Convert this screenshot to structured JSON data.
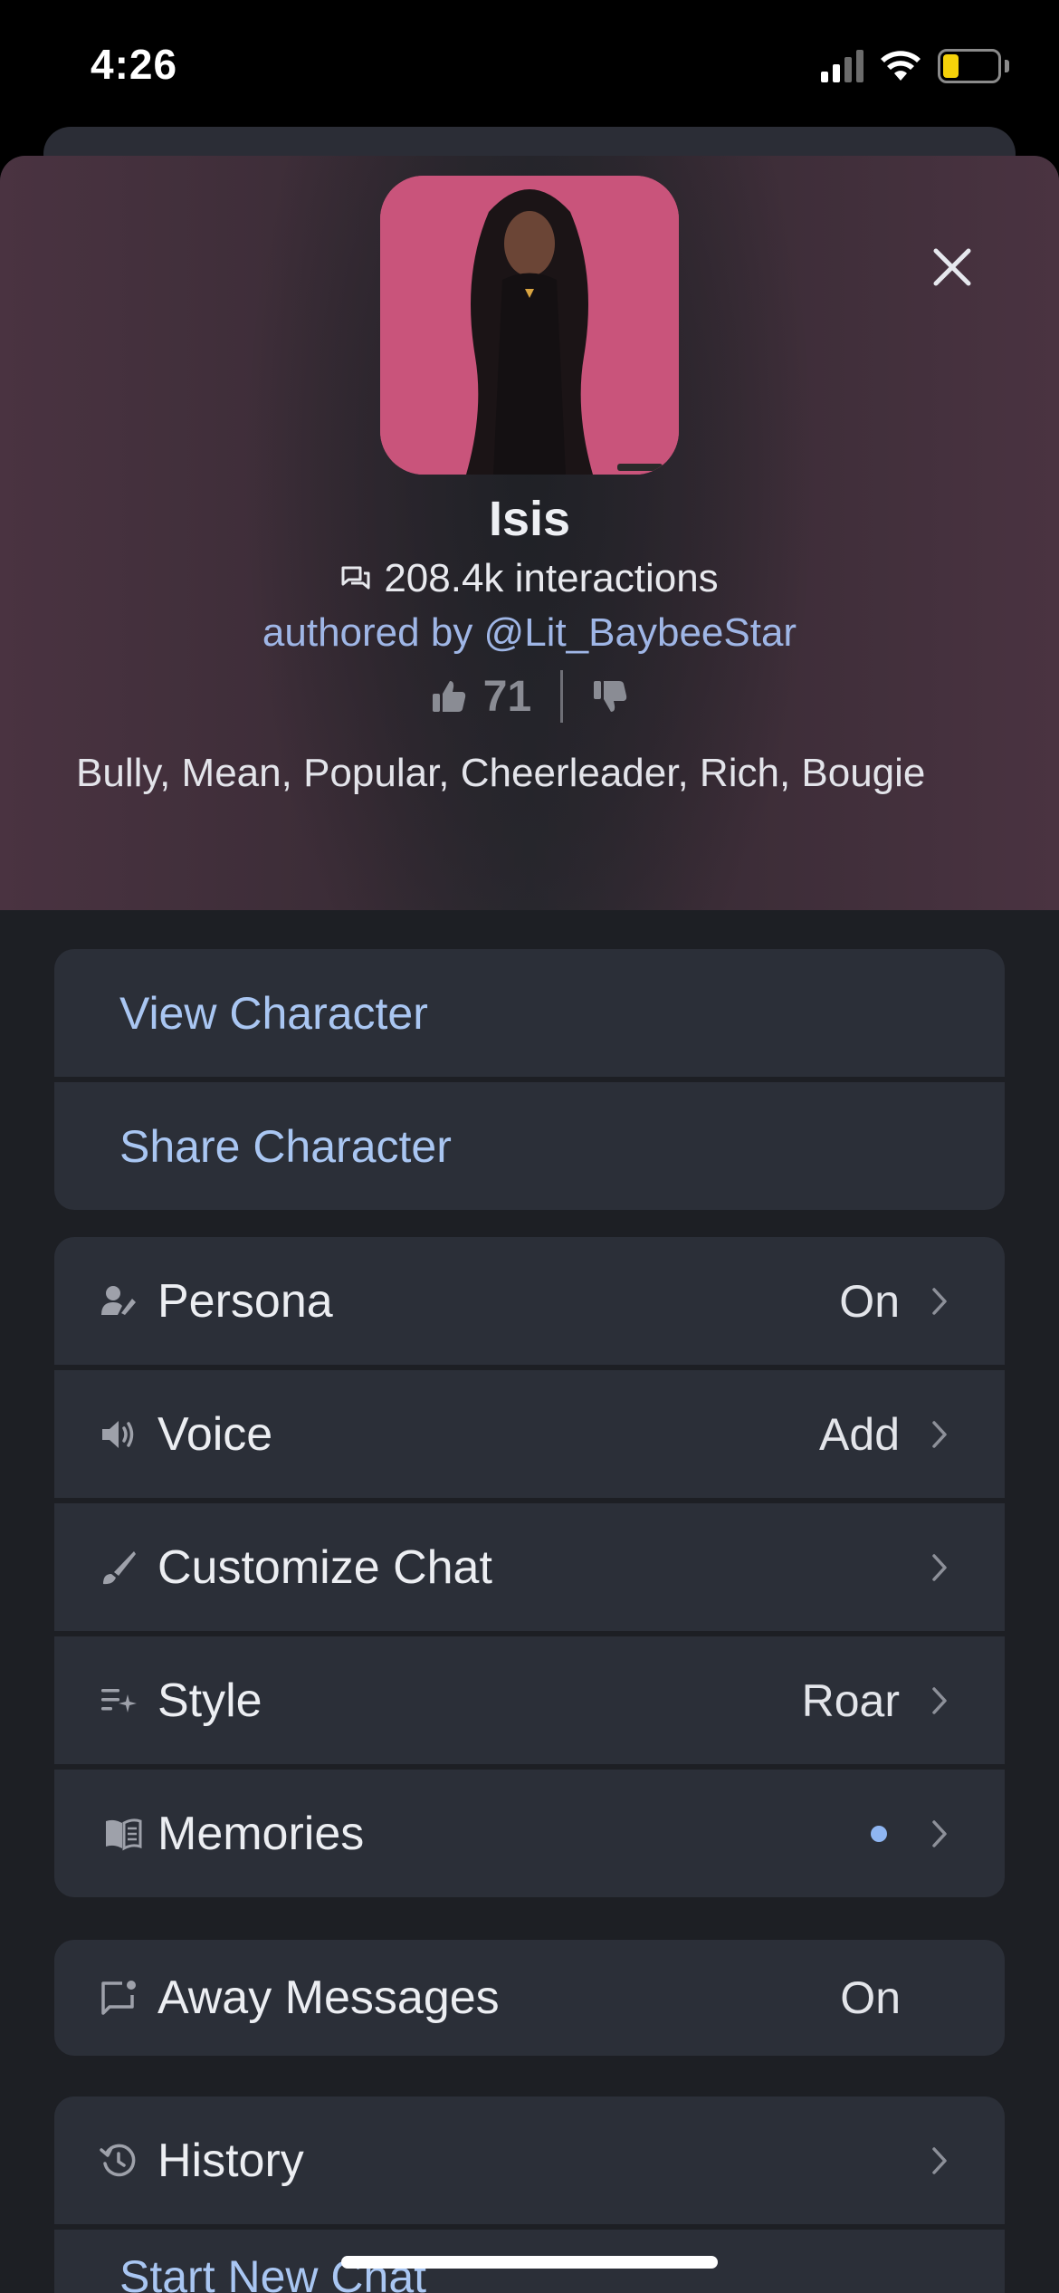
{
  "status_bar": {
    "time": "4:26",
    "battery": "9"
  },
  "character": {
    "name": "Isis",
    "interactions": "208.4k interactions",
    "author": "authored by @Lit_BaybeeStar",
    "likes": "71",
    "tags": "Bully, Mean, Popular, Cheerleader, Rich, Bougie"
  },
  "actions": {
    "view_character": "View Character",
    "share_character": "Share Character"
  },
  "settings": [
    {
      "label": "Persona",
      "value": "On",
      "icon": "persona-icon"
    },
    {
      "label": "Voice",
      "value": "Add",
      "icon": "speaker-icon"
    },
    {
      "label": "Customize Chat",
      "value": "",
      "icon": "brush-icon"
    },
    {
      "label": "Style",
      "value": "Roar",
      "icon": "style-sparkle-icon"
    },
    {
      "label": "Memories",
      "value": "",
      "icon": "book-icon"
    }
  ],
  "away_messages": {
    "label": "Away Messages",
    "value": "On"
  },
  "history": {
    "label": "History",
    "start_new_chat": "Start New Chat"
  },
  "colors": {
    "accent_link": "#a9c6f2",
    "avatar_bg": "#c9547b",
    "memory_dot": "#8fb6f2"
  }
}
